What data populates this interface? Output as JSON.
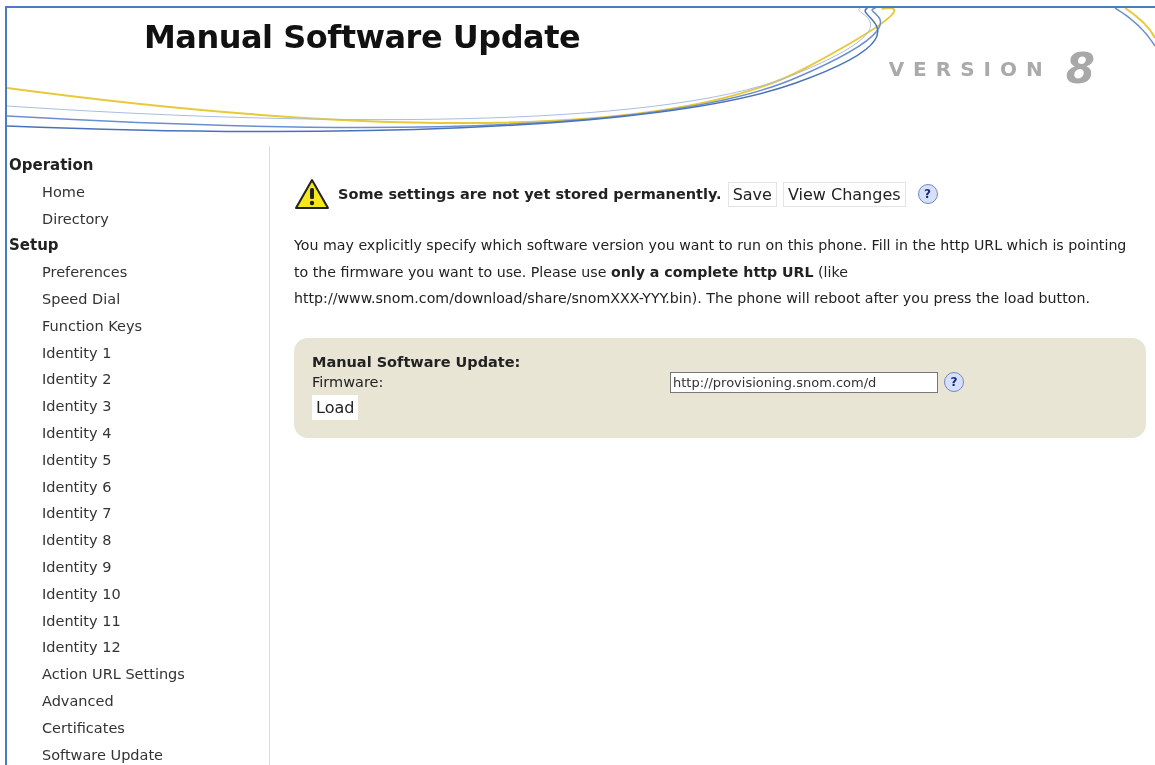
{
  "header": {
    "title": "Manual Software Update",
    "version_label": "VERSION",
    "version_number": "8"
  },
  "sidebar": {
    "groups": [
      {
        "title": "Operation",
        "items": [
          "Home",
          "Directory"
        ]
      },
      {
        "title": "Setup",
        "items": [
          "Preferences",
          "Speed Dial",
          "Function Keys",
          "Identity 1",
          "Identity 2",
          "Identity 3",
          "Identity 4",
          "Identity 5",
          "Identity 6",
          "Identity 7",
          "Identity 8",
          "Identity 9",
          "Identity 10",
          "Identity 11",
          "Identity 12",
          "Action URL Settings",
          "Advanced",
          "Certificates",
          "Software Update"
        ]
      }
    ]
  },
  "notice": {
    "message": "Some settings are not yet stored permanently.",
    "buttons": [
      "Save",
      "View Changes"
    ],
    "help": "?"
  },
  "description": "You may explicitly specify which software version you want to run on this phone. Fill in the http URL which is pointing to the firmware you want to use. Please use **only a complete http URL** (like http://www.snom.com/download/share/snomXXX-YYY.bin). The phone will reboot after you press the load button.",
  "form": {
    "title": "Manual Software Update:",
    "field_label": "Firmware:",
    "field_value": "http://provisioning.snom.com/d",
    "help": "?",
    "button": "Load"
  }
}
